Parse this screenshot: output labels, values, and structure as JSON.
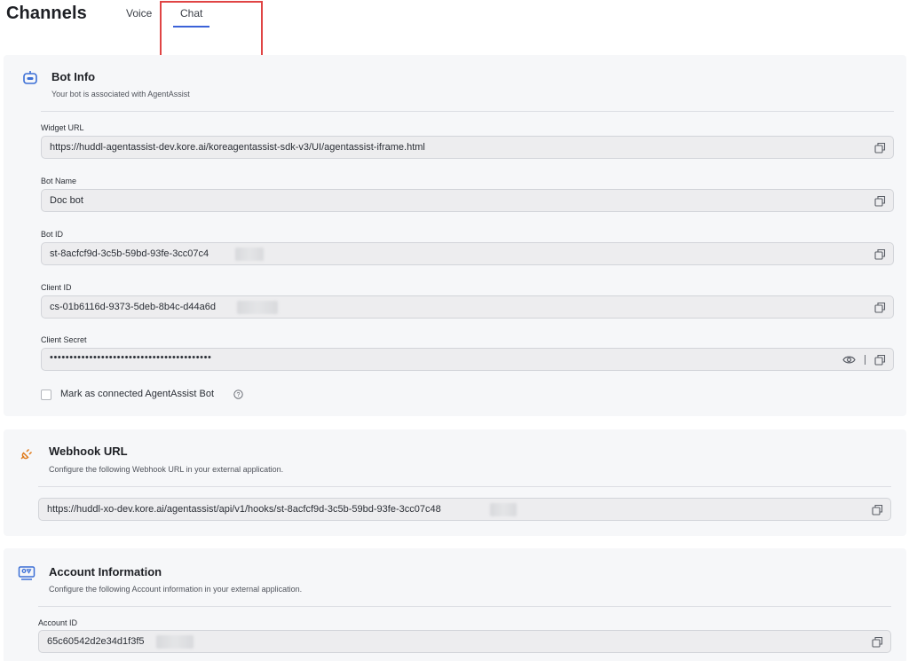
{
  "header": {
    "title": "Channels",
    "tabs": [
      {
        "label": "Voice",
        "active": false
      },
      {
        "label": "Chat",
        "active": true
      }
    ]
  },
  "colors": {
    "accent": "#3b62d8",
    "highlight": "#e04444",
    "card_bg": "#f6f7f9",
    "icon_blue": "#3b6fd6",
    "icon_orange": "#e07b1c"
  },
  "bot_info": {
    "icon": "bot-icon",
    "title": "Bot Info",
    "subtitle": "Your bot is associated with AgentAssist",
    "fields": {
      "widget_url": {
        "label": "Widget URL",
        "value": "https://huddl-agentassist-dev.kore.ai/koreagentassist-sdk-v3/UI/agentassist-iframe.html"
      },
      "bot_name": {
        "label": "Bot Name",
        "value": "Doc bot"
      },
      "bot_id": {
        "label": "Bot ID",
        "value": "st-8acfcf9d-3c5b-59bd-93fe-3cc07c4"
      },
      "client_id": {
        "label": "Client ID",
        "value": "cs-01b6116d-9373-5deb-8b4c-d44a6d"
      },
      "client_secret": {
        "label": "Client Secret",
        "value": "•••••••••••••••••••••••••••••••••••••••••"
      }
    },
    "checkbox": {
      "label": "Mark as connected AgentAssist Bot",
      "checked": false
    }
  },
  "webhook": {
    "icon": "plug-icon",
    "title": "Webhook URL",
    "subtitle": "Configure the following Webhook URL in your external application.",
    "value": "https://huddl-xo-dev.kore.ai/agentassist/api/v1/hooks/st-8acfcf9d-3c5b-59bd-93fe-3cc07c48"
  },
  "account": {
    "icon": "account-card-icon",
    "title": "Account Information",
    "subtitle": "Configure the following Account information in your external application.",
    "account_id": {
      "label": "Account ID",
      "value": "65c60542d2e34d1f3f5"
    }
  }
}
